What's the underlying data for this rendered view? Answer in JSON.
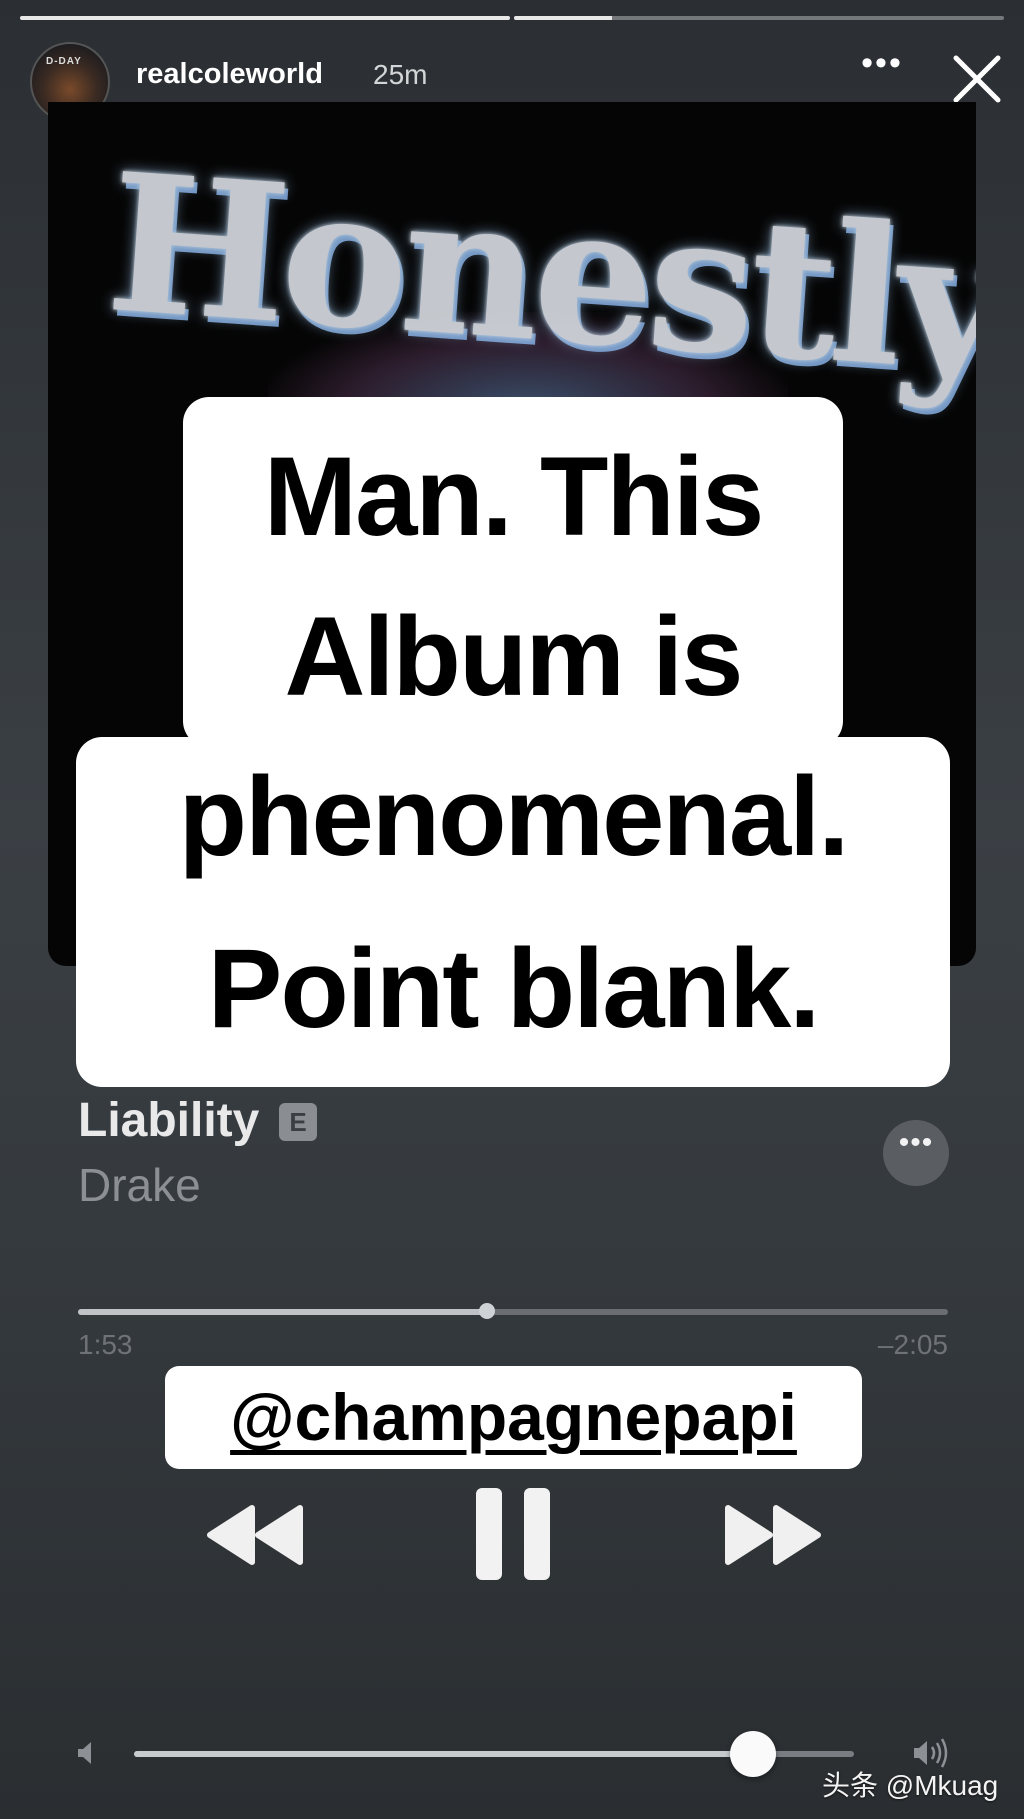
{
  "story": {
    "progress": [
      1.0,
      0.2
    ],
    "username": "realcoleworld",
    "time": "25m",
    "avatar_label": "D-DAY"
  },
  "album_art": {
    "title_text": "Honestly"
  },
  "caption": {
    "line1": "Man. This",
    "line2": "Album is",
    "line3": "phenomenal.",
    "line4": "Point blank."
  },
  "track": {
    "title": "Liability",
    "explicit_badge": "E",
    "artist": "Drake",
    "more_label": "•••"
  },
  "playback": {
    "elapsed": "1:53",
    "remaining": "–2:05",
    "progress_fraction": 0.47
  },
  "mention": "@champagnepapi",
  "volume": {
    "level_fraction": 0.86
  },
  "watermark": "头条 @Mkuag",
  "header_more_label": "•••",
  "icons": {
    "close": "close-icon",
    "prev": "rewind-icon",
    "pause": "pause-icon",
    "next": "fast-forward-icon",
    "volume_low": "volume-low-icon",
    "volume_high": "volume-high-icon"
  }
}
